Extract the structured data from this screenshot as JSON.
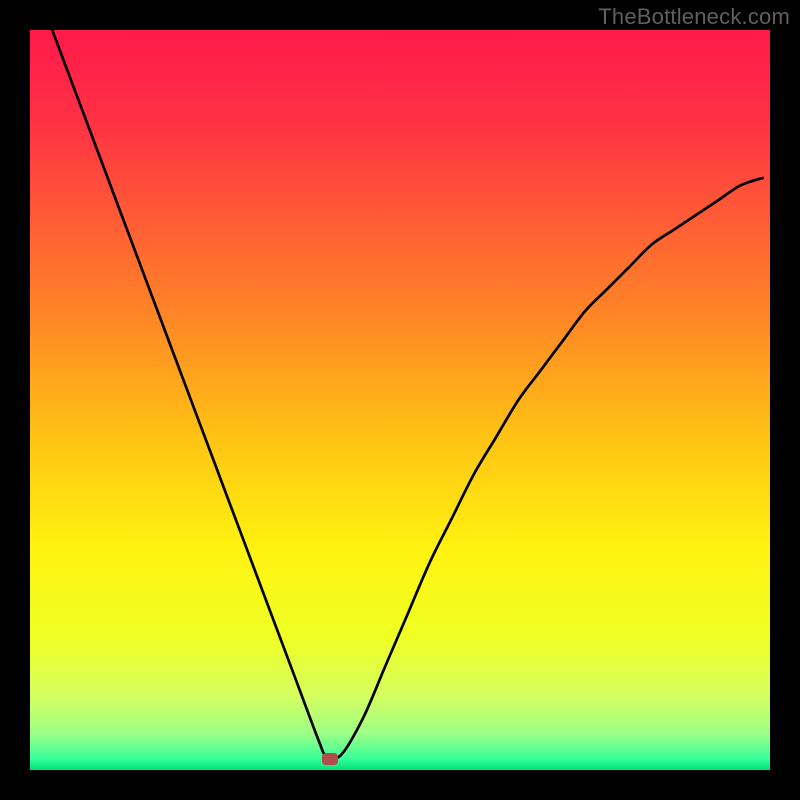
{
  "watermark": "TheBottleneck.com",
  "chart_data": {
    "type": "line",
    "title": "",
    "xlabel": "",
    "ylabel": "",
    "x_range": [
      0,
      1
    ],
    "y_range": [
      0,
      1
    ],
    "series": [
      {
        "name": "curve",
        "x": [
          0.03,
          0.06,
          0.09,
          0.12,
          0.15,
          0.18,
          0.21,
          0.24,
          0.27,
          0.3,
          0.33,
          0.36,
          0.39,
          0.4,
          0.42,
          0.45,
          0.48,
          0.51,
          0.54,
          0.57,
          0.6,
          0.63,
          0.66,
          0.69,
          0.72,
          0.75,
          0.78,
          0.81,
          0.84,
          0.87,
          0.9,
          0.93,
          0.96,
          0.99
        ],
        "y": [
          1.0,
          0.92,
          0.84,
          0.76,
          0.68,
          0.6,
          0.52,
          0.44,
          0.36,
          0.28,
          0.2,
          0.12,
          0.04,
          0.02,
          0.02,
          0.07,
          0.14,
          0.21,
          0.28,
          0.34,
          0.4,
          0.45,
          0.5,
          0.54,
          0.58,
          0.62,
          0.65,
          0.68,
          0.71,
          0.73,
          0.75,
          0.77,
          0.79,
          0.8
        ]
      }
    ],
    "marker": {
      "x": 0.405,
      "y": 0.015
    },
    "gradient_stops": [
      {
        "pos": 0.0,
        "color": "#ff1a4a"
      },
      {
        "pos": 0.12,
        "color": "#ff3044"
      },
      {
        "pos": 0.25,
        "color": "#ff5a36"
      },
      {
        "pos": 0.4,
        "color": "#ff8a24"
      },
      {
        "pos": 0.55,
        "color": "#ffc314"
      },
      {
        "pos": 0.7,
        "color": "#fff210"
      },
      {
        "pos": 0.82,
        "color": "#f0ff24"
      },
      {
        "pos": 0.9,
        "color": "#d4ff60"
      },
      {
        "pos": 0.95,
        "color": "#9eff86"
      },
      {
        "pos": 0.985,
        "color": "#36ff99"
      },
      {
        "pos": 1.0,
        "color": "#00e078"
      }
    ]
  }
}
